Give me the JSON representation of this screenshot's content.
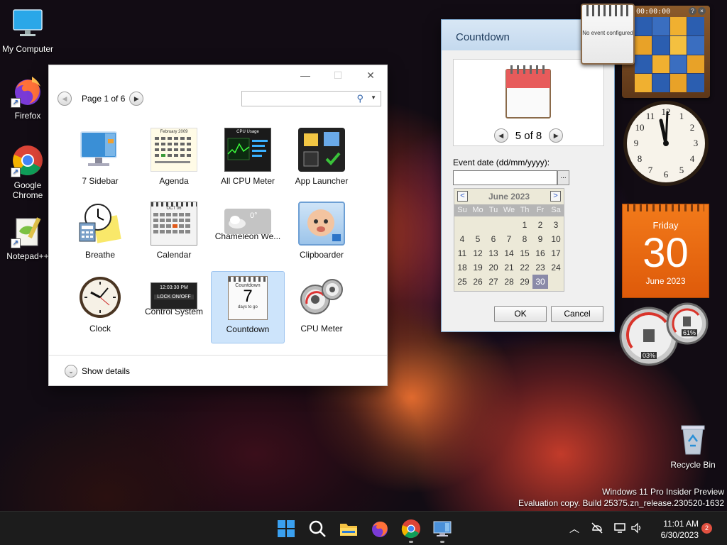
{
  "desktop": {
    "icons": [
      {
        "label": "My Computer"
      },
      {
        "label": "Firefox"
      },
      {
        "label": "Google Chrome"
      },
      {
        "label": "Notepad++"
      }
    ],
    "recycle_bin": "Recycle Bin",
    "watermark_line1": "Windows 11 Pro Insider Preview",
    "watermark_line2": "Evaluation copy. Build 25375.zn_release.230520-1632"
  },
  "gallery": {
    "page_label": "Page 1 of 6",
    "search_placeholder": "",
    "gadgets": [
      {
        "label": "7 Sidebar"
      },
      {
        "label": "Agenda"
      },
      {
        "label": "All CPU Meter"
      },
      {
        "label": "App Launcher"
      },
      {
        "label": "Breathe"
      },
      {
        "label": "Calendar"
      },
      {
        "label": "Chameleon We..."
      },
      {
        "label": "Clipboarder"
      },
      {
        "label": "Clock"
      },
      {
        "label": "Control System"
      },
      {
        "label": "Countdown",
        "selected": true
      },
      {
        "label": "CPU Meter"
      }
    ],
    "agenda_thumb_text": "February 2009",
    "cpu_thumb_text": "CPU Usage",
    "chameleon_temp": "0°",
    "control_time": "12:03:30 PM",
    "control_lock": "LOCK ON/OFF",
    "countdown_thumb_title": "Countdown",
    "countdown_thumb_num": "7",
    "countdown_thumb_sub": "days to go",
    "calendar_thumb_month": "OCT 06",
    "show_details": "Show details"
  },
  "countdown_dialog": {
    "title": "Countdown",
    "nav_label": "5 of 8",
    "event_label": "Event date (dd/mm/yyyy):",
    "event_value": "",
    "browse_label": "...",
    "ok": "OK",
    "cancel": "Cancel",
    "calendar": {
      "prev": "<",
      "next": ">",
      "month": "June 2023",
      "dow": [
        "Su",
        "Mo",
        "Tu",
        "We",
        "Th",
        "Fr",
        "Sa"
      ],
      "rows": [
        [
          "",
          "",
          "",
          "",
          "1",
          "2",
          "3"
        ],
        [
          "4",
          "5",
          "6",
          "7",
          "8",
          "9",
          "10"
        ],
        [
          "11",
          "12",
          "13",
          "14",
          "15",
          "16",
          "17"
        ],
        [
          "18",
          "19",
          "20",
          "21",
          "22",
          "23",
          "24"
        ],
        [
          "25",
          "26",
          "27",
          "28",
          "29",
          "30",
          ""
        ]
      ],
      "selected": "30"
    }
  },
  "gadgets": {
    "mini_countdown_text": "No event configured",
    "puzzle_time": "00:00:00",
    "puzzle_help": "?",
    "puzzle_close": "×",
    "calendar_day": "Friday",
    "calendar_num": "30",
    "calendar_month_year": "June 2023",
    "cpu_percent": "03%",
    "ram_percent": "61%"
  },
  "taskbar": {
    "time": "11:01 AM",
    "date": "6/30/2023",
    "notifications": "2"
  }
}
